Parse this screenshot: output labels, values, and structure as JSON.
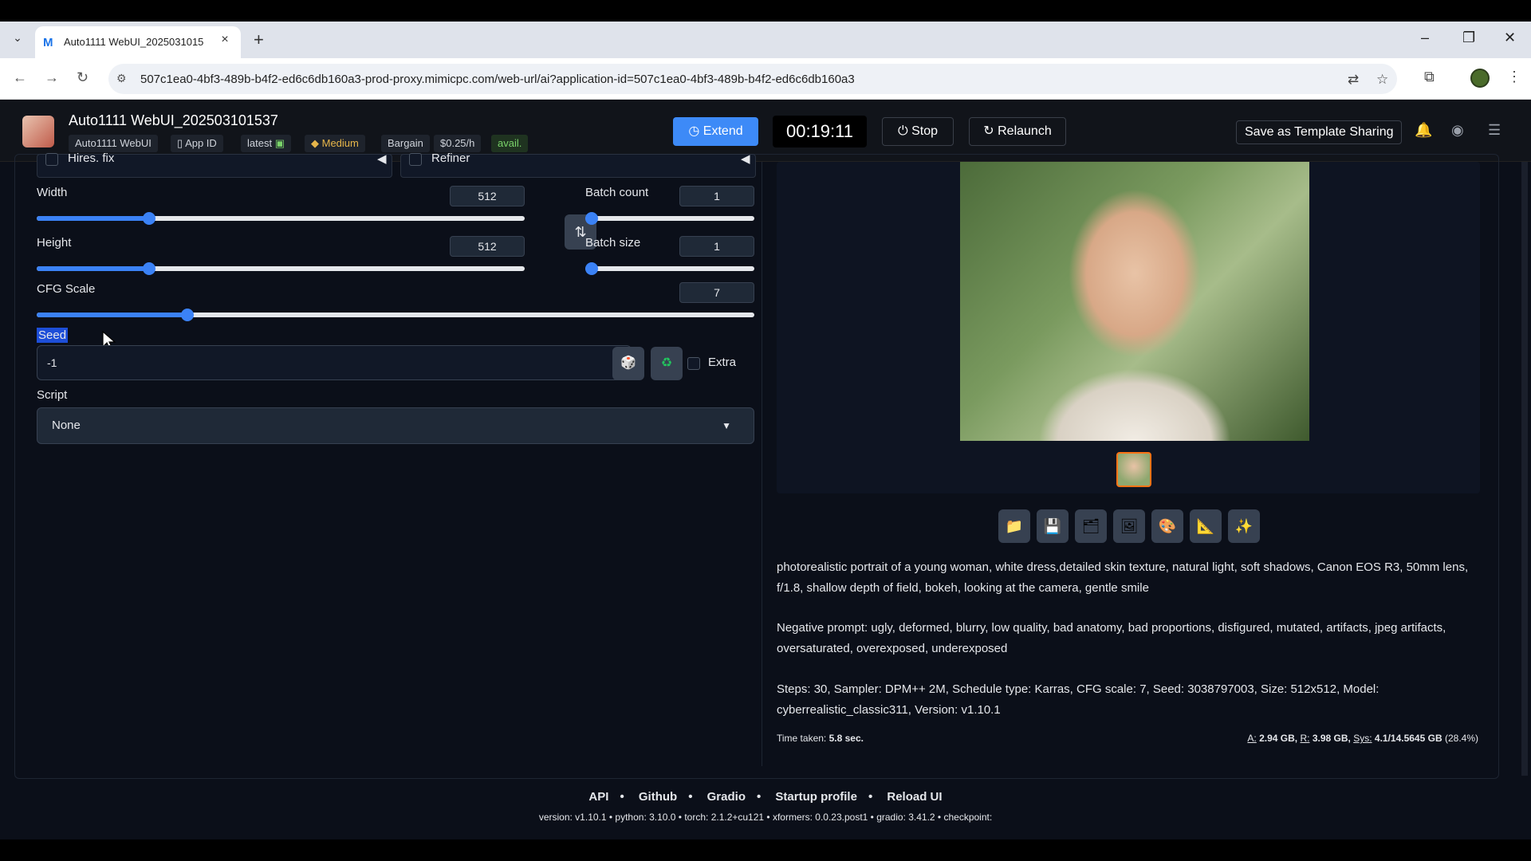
{
  "browser": {
    "tab_title": "Auto1111 WebUI_2025031015",
    "url": "507c1ea0-4bf3-489b-b4f2-ed6c6db160a3-prod-proxy.mimicpc.com/web-url/ai?application-id=507c1ea0-4bf3-489b-b4f2-ed6c6db160a3"
  },
  "header": {
    "title": "Auto1111 WebUI_202503101537",
    "chip_app": "Auto1111 WebUI",
    "chip_appid": "App ID",
    "chip_latest": "latest",
    "chip_medium": "Medium",
    "chip_bargain": "Bargain",
    "chip_price": "$0.25/h",
    "chip_avail": "avail.",
    "extend": "Extend",
    "timer": "00:19:11",
    "stop": "Stop",
    "relaunch": "Relaunch",
    "template": "Save as Template Sharing"
  },
  "left": {
    "hires_label": "Hires. fix",
    "refiner_label": "Refiner",
    "width_label": "Width",
    "width_value": "512",
    "width_fraction": 0.23,
    "height_label": "Height",
    "height_value": "512",
    "height_fraction": 0.23,
    "batch_count_label": "Batch count",
    "batch_count_value": "1",
    "batch_size_label": "Batch size",
    "batch_size_value": "1",
    "cfg_label": "CFG Scale",
    "cfg_value": "7",
    "cfg_fraction": 0.21,
    "seed_label": "Seed",
    "seed_value": "-1",
    "extra_label": "Extra",
    "script_label": "Script",
    "script_value": "None"
  },
  "right": {
    "prompt": "photorealistic portrait of a young woman, white dress,detailed skin texture, natural light, soft shadows, Canon EOS R3, 50mm lens, f/1.8, shallow depth of field, bokeh, looking at the camera, gentle smile",
    "negative": "Negative prompt: ugly, deformed, blurry, low quality, bad anatomy, bad proportions, disfigured, mutated, artifacts, jpeg artifacts, oversaturated, overexposed, underexposed",
    "params": "Steps: 30, Sampler: DPM++ 2M, Schedule type: Karras, CFG scale: 7, Seed: 3038797003, Size: 512x512, Model: cyberrealistic_classic311, Version: v1.10.1",
    "time_label": "Time taken:",
    "time_value": "5.8 sec.",
    "mem_a_label": "A:",
    "mem_a": "2.94 GB,",
    "mem_r_label": "R:",
    "mem_r": "3.98 GB,",
    "mem_sys_label": "Sys:",
    "mem_sys": "4.1/14.5645 GB",
    "mem_pct": "(28.4%)"
  },
  "footer": {
    "links": [
      "API",
      "Github",
      "Gradio",
      "Startup profile",
      "Reload UI"
    ],
    "version_line": "version: v1.10.1  •  python: 3.10.0  •  torch: 2.1.2+cu121  •  xformers: 0.0.23.post1  •  gradio: 3.41.2  •  checkpoint:"
  }
}
